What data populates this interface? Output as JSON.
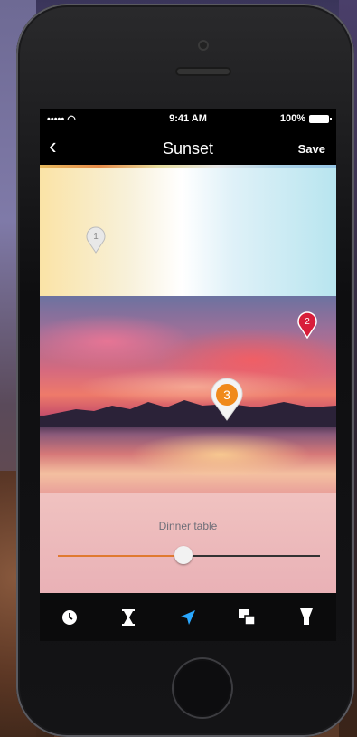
{
  "status_bar": {
    "signal": "••••• ◠",
    "time": "9:41 AM",
    "battery": "100%"
  },
  "nav": {
    "back_icon": "chevron-left-icon",
    "back_glyph": "‹",
    "title": "Sunset",
    "save_label": "Save"
  },
  "markers": [
    {
      "label": "1",
      "color": "#e8e8e8",
      "text_color": "#888888"
    },
    {
      "label": "2",
      "color": "#d81e3a",
      "text_color": "#ffffff"
    },
    {
      "label": "3",
      "color": "#f08a1c",
      "text_color": "#ffffff"
    }
  ],
  "selected_light": {
    "name": "Dinner table",
    "brightness": 0.48
  },
  "colors": {
    "accent": "#e07a30",
    "active_tab": "#2aa8ff"
  },
  "tabs": [
    {
      "name": "clock-icon",
      "active": false
    },
    {
      "name": "hourglass-icon",
      "active": false
    },
    {
      "name": "location-arrow-icon",
      "active": true
    },
    {
      "name": "scenes-icon",
      "active": false
    },
    {
      "name": "bulb-icon",
      "active": false
    }
  ]
}
